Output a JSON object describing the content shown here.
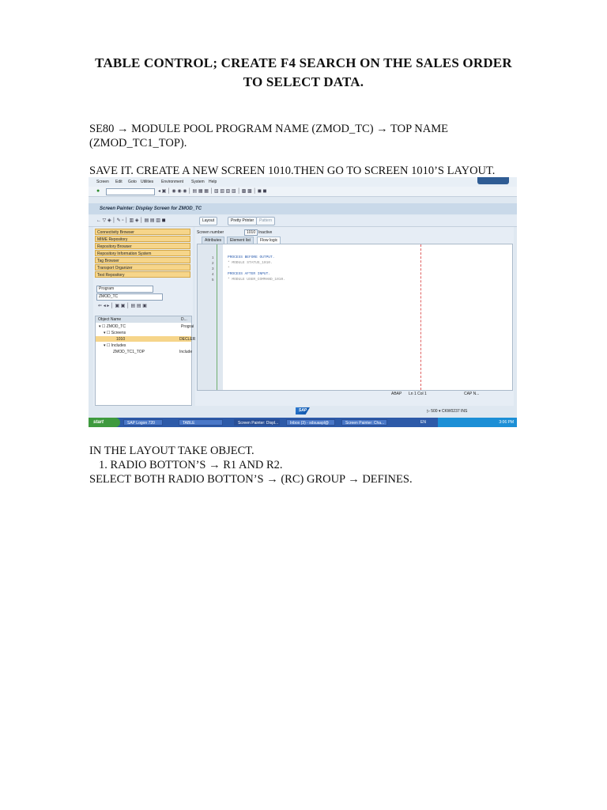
{
  "document": {
    "title_line1": "TABLE CONTROL; CREATE F4 SEARCH ON THE SALES ORDER",
    "title_line2": "TO SELECT DATA.",
    "para1_line1": "SE80 →  MODULE POOL PROGRAM NAME (ZMOD_TC) → TOP NAME",
    "para1_line2": "(ZMOD_TC1_TOP).",
    "para2": "SAVE IT. CREATE A NEW SCREEN 1010.THEN GO TO SCREEN 1010’S LAYOUT.",
    "para3": "IN THE LAYOUT TAKE OBJECT.",
    "list_item1": "1.   RADIO BOTTON’S → R1 AND R2.",
    "para4": "SELECT BOTH RADIO BOTTON’S → (RC) GROUP → DEFINES."
  },
  "screenshot": {
    "menu": [
      "Screen",
      "Edit",
      "Goto",
      "Utilities",
      "Environment",
      "System",
      "Help"
    ],
    "window_title": "Screen Painter: Display Screen for ZMOD_TC",
    "toolbar": {
      "layout_btn": "Layout",
      "pretty_printer": "Pretty Printer",
      "pattern": "Pattern"
    },
    "nav_buttons": [
      "Connectivity Browser",
      "MIME Repository",
      "Repository Browser",
      "Repository Information System",
      "Tag Browser",
      "Transport Organizer",
      "Test Repository"
    ],
    "object_type": "Program",
    "object_name": "ZMOD_TC",
    "screen_number_label": "Screen number",
    "screen_number": "1010",
    "screen_status": "Inactive",
    "tabs": [
      "Attributes",
      "Element list",
      "Flow logic"
    ],
    "tree_header": {
      "col1": "Object Name",
      "col2": "D..."
    },
    "tree": [
      {
        "label": "▾ ☐ ZMOD_TC",
        "desc": "Prograi"
      },
      {
        "label": "▾ ☐ Screens",
        "desc": ""
      },
      {
        "label": "1010",
        "desc": "DECLER"
      },
      {
        "label": "▾ ☐ Includes",
        "desc": ""
      },
      {
        "label": "ZMOD_TC1_TOP",
        "desc": "Include"
      }
    ],
    "code": [
      "PROCESS BEFORE OUTPUT.",
      "* MODULE STATUS_1010.",
      "*",
      "PROCESS AFTER INPUT.",
      "* MODULE USER_COMMAND_1010."
    ],
    "line_numbers": [
      "1",
      "2",
      "3",
      "4",
      "5"
    ],
    "status_bar": {
      "lang": "ABAP",
      "pos": "Ln  1 Col  1",
      "mode": "CAP   N..."
    },
    "sap_logo": "SAP",
    "system_status": "▷  500 ▾  CKW0237  INS",
    "taskbar": {
      "start": "start",
      "items": [
        "SAP Logon 720",
        "TABLE CONTROL.doc",
        "Screen Painter: Displ...",
        "Inbox (3) - sdsuaspl@",
        "Screen Painter: Cha..."
      ],
      "lang": "EN",
      "clock": "3:06 PM"
    }
  }
}
